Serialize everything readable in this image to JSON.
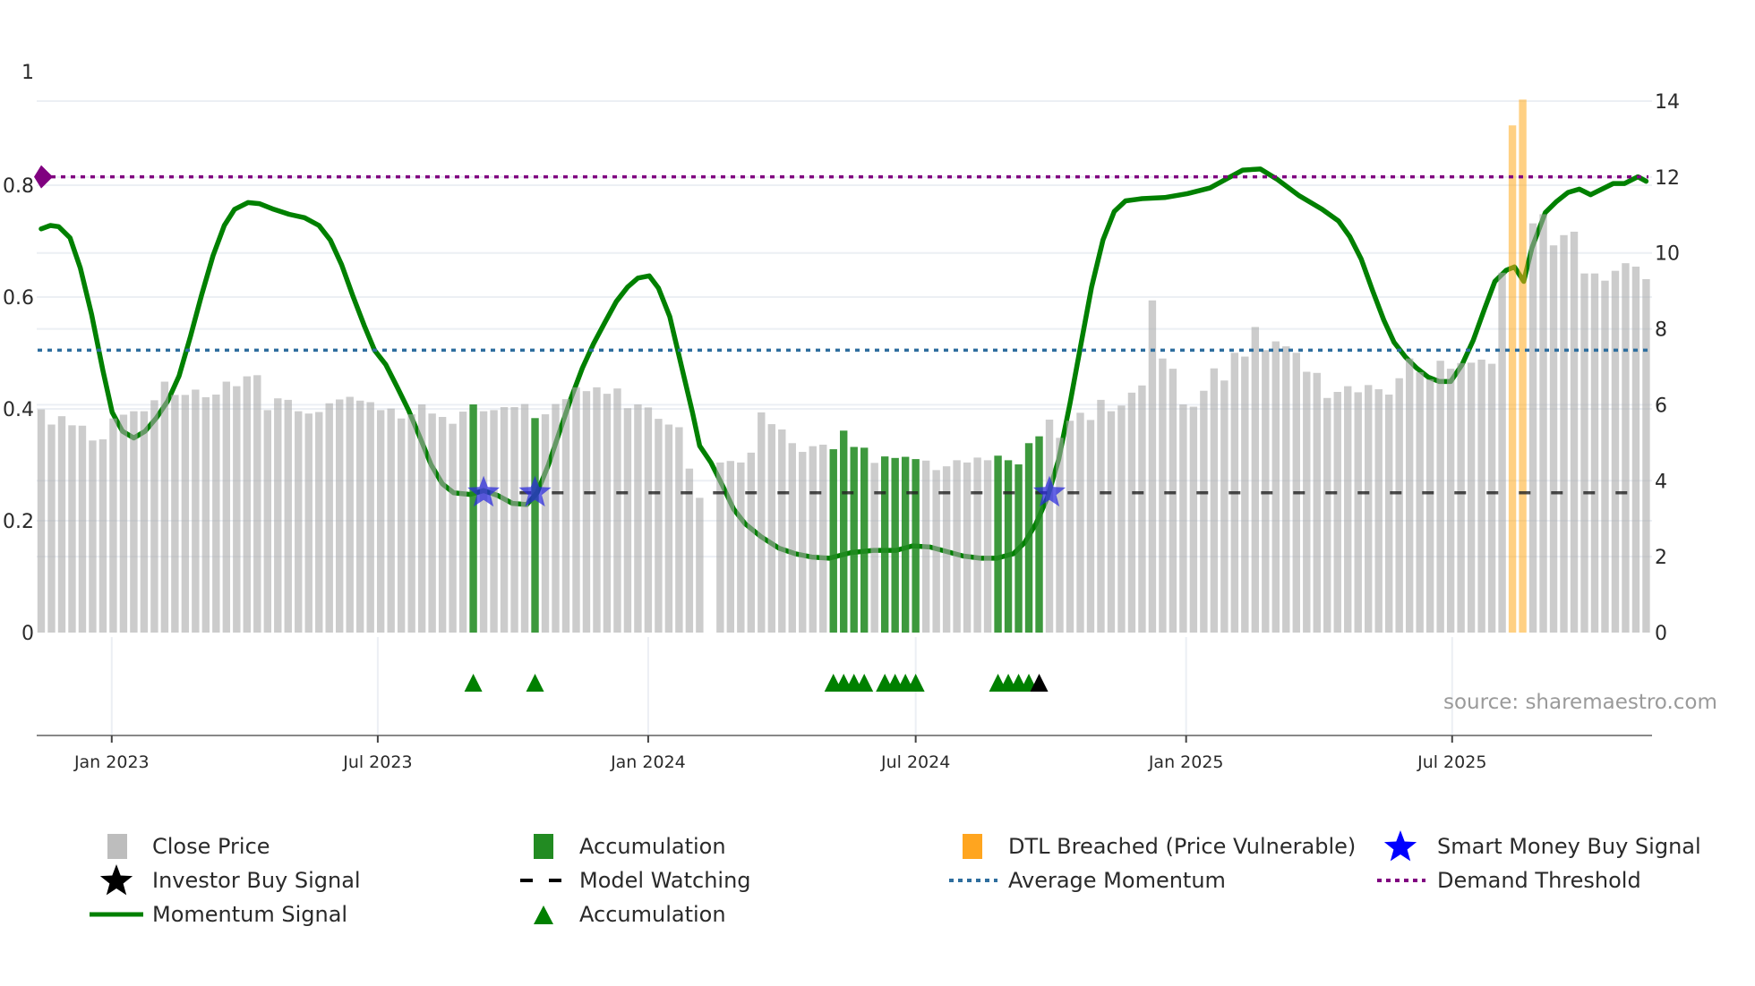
{
  "chart_data": {
    "type": "bar",
    "title": "",
    "source": "source: sharemaestro.com",
    "x_start_date": "2022-11-14",
    "x_interval_days": 7,
    "x_ticks": [
      {
        "label": "Jan 2023",
        "date": "2023-01-01"
      },
      {
        "label": "Jul 2023",
        "date": "2023-07-01"
      },
      {
        "label": "Jan 2024",
        "date": "2024-01-01"
      },
      {
        "label": "Jul 2024",
        "date": "2024-07-01"
      },
      {
        "label": "Jan 2025",
        "date": "2025-01-01"
      },
      {
        "label": "Jul 2025",
        "date": "2025-07-01"
      }
    ],
    "left_axis": {
      "range": [
        0,
        1
      ],
      "ticks": [
        "0",
        "0.2",
        "0.4",
        "0.6",
        "0.8",
        "1"
      ],
      "tick_values": [
        0,
        0.2,
        0.4,
        0.6,
        0.8,
        1
      ]
    },
    "right_axis": {
      "range": [
        0,
        14.74
      ],
      "ticks": [
        "0",
        "2",
        "4",
        "6",
        "8",
        "10",
        "12",
        "14"
      ],
      "tick_values": [
        0,
        2,
        4,
        6,
        8,
        10,
        12,
        14
      ]
    },
    "grid": true,
    "legend_placement": "bottom",
    "close_price": [
      5.88,
      5.48,
      5.7,
      5.46,
      5.45,
      5.06,
      5.09,
      5.64,
      5.74,
      5.83,
      5.83,
      6.12,
      6.61,
      6.26,
      6.26,
      6.4,
      6.2,
      6.27,
      6.61,
      6.49,
      6.75,
      6.78,
      5.86,
      6.17,
      6.13,
      5.83,
      5.77,
      5.81,
      6.04,
      6.14,
      6.21,
      6.11,
      6.07,
      5.86,
      5.9,
      5.64,
      5.75,
      6.01,
      5.77,
      5.68,
      5.5,
      5.82,
      6.01,
      5.83,
      5.86,
      5.94,
      5.94,
      6.02,
      5.65,
      5.75,
      6.02,
      6.15,
      6.46,
      6.36,
      6.46,
      6.29,
      6.43,
      5.91,
      6.01,
      5.93,
      5.63,
      5.48,
      5.41,
      4.32,
      3.55,
      null,
      4.48,
      4.52,
      4.48,
      4.74,
      5.8,
      5.49,
      5.35,
      4.99,
      4.76,
      4.91,
      4.95,
      4.83,
      5.32,
      4.89,
      4.87,
      4.47,
      4.64,
      4.6,
      4.63,
      4.57,
      4.53,
      4.28,
      4.38,
      4.54,
      4.48,
      4.61,
      4.54,
      4.66,
      4.54,
      4.43,
      4.99,
      5.17,
      5.61,
      5.13,
      5.58,
      5.79,
      5.6,
      6.13,
      5.83,
      5.98,
      6.32,
      6.51,
      8.75,
      7.22,
      6.95,
      6.01,
      5.95,
      6.37,
      6.96,
      6.64,
      7.37,
      7.27,
      8.05,
      7.44,
      7.67,
      7.54,
      7.37,
      6.87,
      6.84,
      6.18,
      6.34,
      6.49,
      6.33,
      6.52,
      6.41,
      6.27,
      6.7,
      7.22,
      6.86,
      6.67,
      7.16,
      6.95,
      7.1,
      7.11,
      7.19,
      7.08,
      9.48,
      13.36,
      14.04,
      10.78,
      11.02,
      10.2,
      10.47,
      10.56,
      9.46,
      9.46,
      9.27,
      9.53,
      9.73,
      9.64,
      9.31
    ],
    "accumulation_bar_indices": [
      42,
      48,
      77,
      78,
      79,
      80,
      82,
      83,
      84,
      85,
      93,
      94,
      95,
      96,
      97
    ],
    "dtl_breached_bar_indices": [
      143,
      144
    ],
    "accumulation_triangles": [
      {
        "i": 42,
        "color": "#008000"
      },
      {
        "i": 48,
        "color": "#008000"
      },
      {
        "i": 77,
        "color": "#008000"
      },
      {
        "i": 78,
        "color": "#008000"
      },
      {
        "i": 79,
        "color": "#008000"
      },
      {
        "i": 80,
        "color": "#008000"
      },
      {
        "i": 82,
        "color": "#008000"
      },
      {
        "i": 83,
        "color": "#008000"
      },
      {
        "i": 84,
        "color": "#008000"
      },
      {
        "i": 85,
        "color": "#008000"
      },
      {
        "i": 93,
        "color": "#008000"
      },
      {
        "i": 94,
        "color": "#008000"
      },
      {
        "i": 95,
        "color": "#008000"
      },
      {
        "i": 96,
        "color": "#008000"
      },
      {
        "i": 97,
        "color": "#000000"
      }
    ],
    "smart_money_signals": [
      {
        "i": 43,
        "value": 0.25
      },
      {
        "i": 48,
        "value": 0.25
      },
      {
        "i": 98,
        "value": 0.25
      }
    ],
    "model_watching": {
      "value": 0.25,
      "from_index": 46.5,
      "to_index": 156
    },
    "average_momentum": 0.505,
    "demand_threshold": 0.815,
    "momentum_signal": [
      [
        0,
        0.722
      ],
      [
        0.9,
        0.728
      ],
      [
        1.7,
        0.726
      ],
      [
        2.8,
        0.706
      ],
      [
        3.8,
        0.652
      ],
      [
        4.9,
        0.569
      ],
      [
        6.0,
        0.469
      ],
      [
        6.9,
        0.394
      ],
      [
        7.9,
        0.36
      ],
      [
        9.0,
        0.348
      ],
      [
        10.1,
        0.36
      ],
      [
        11.2,
        0.384
      ],
      [
        12.3,
        0.414
      ],
      [
        13.4,
        0.459
      ],
      [
        14.5,
        0.529
      ],
      [
        15.6,
        0.604
      ],
      [
        16.7,
        0.674
      ],
      [
        17.8,
        0.728
      ],
      [
        18.8,
        0.757
      ],
      [
        20.1,
        0.769
      ],
      [
        21.2,
        0.767
      ],
      [
        22.6,
        0.757
      ],
      [
        24.1,
        0.748
      ],
      [
        25.6,
        0.742
      ],
      [
        27.0,
        0.728
      ],
      [
        28.1,
        0.702
      ],
      [
        29.2,
        0.658
      ],
      [
        30.3,
        0.602
      ],
      [
        31.4,
        0.549
      ],
      [
        32.4,
        0.505
      ],
      [
        33.5,
        0.479
      ],
      [
        34.6,
        0.439
      ],
      [
        35.7,
        0.398
      ],
      [
        36.8,
        0.35
      ],
      [
        37.9,
        0.3
      ],
      [
        39.0,
        0.266
      ],
      [
        40.1,
        0.25
      ],
      [
        41.7,
        0.247
      ],
      [
        43.0,
        0.254
      ],
      [
        44.4,
        0.245
      ],
      [
        45.8,
        0.231
      ],
      [
        47.2,
        0.229
      ],
      [
        48.2,
        0.25
      ],
      [
        49.3,
        0.3
      ],
      [
        50.4,
        0.36
      ],
      [
        51.5,
        0.419
      ],
      [
        52.6,
        0.473
      ],
      [
        53.7,
        0.517
      ],
      [
        54.8,
        0.555
      ],
      [
        55.9,
        0.592
      ],
      [
        57.0,
        0.618
      ],
      [
        58.0,
        0.634
      ],
      [
        59.1,
        0.638
      ],
      [
        60.0,
        0.616
      ],
      [
        61.1,
        0.565
      ],
      [
        62.2,
        0.479
      ],
      [
        63.3,
        0.394
      ],
      [
        64.0,
        0.334
      ],
      [
        65.1,
        0.304
      ],
      [
        66.2,
        0.264
      ],
      [
        67.3,
        0.221
      ],
      [
        68.4,
        0.195
      ],
      [
        70.0,
        0.171
      ],
      [
        71.7,
        0.151
      ],
      [
        73.3,
        0.141
      ],
      [
        74.9,
        0.135
      ],
      [
        76.6,
        0.133
      ],
      [
        78.7,
        0.143
      ],
      [
        80.9,
        0.147
      ],
      [
        83.1,
        0.147
      ],
      [
        84.7,
        0.155
      ],
      [
        86.4,
        0.153
      ],
      [
        88.0,
        0.145
      ],
      [
        89.6,
        0.137
      ],
      [
        91.3,
        0.133
      ],
      [
        92.9,
        0.133
      ],
      [
        94.5,
        0.141
      ],
      [
        95.6,
        0.161
      ],
      [
        96.7,
        0.195
      ],
      [
        97.8,
        0.241
      ],
      [
        98.9,
        0.31
      ],
      [
        100.0,
        0.41
      ],
      [
        101.1,
        0.519
      ],
      [
        102.1,
        0.618
      ],
      [
        103.2,
        0.702
      ],
      [
        104.3,
        0.753
      ],
      [
        105.4,
        0.772
      ],
      [
        107.0,
        0.776
      ],
      [
        109.2,
        0.778
      ],
      [
        111.4,
        0.785
      ],
      [
        113.6,
        0.795
      ],
      [
        115.2,
        0.811
      ],
      [
        116.8,
        0.827
      ],
      [
        118.5,
        0.829
      ],
      [
        120.1,
        0.811
      ],
      [
        122.3,
        0.781
      ],
      [
        124.5,
        0.757
      ],
      [
        126.1,
        0.736
      ],
      [
        127.2,
        0.708
      ],
      [
        128.3,
        0.668
      ],
      [
        129.4,
        0.612
      ],
      [
        130.5,
        0.559
      ],
      [
        131.5,
        0.519
      ],
      [
        132.6,
        0.493
      ],
      [
        133.7,
        0.473
      ],
      [
        134.8,
        0.457
      ],
      [
        135.9,
        0.449
      ],
      [
        137.0,
        0.449
      ],
      [
        138.1,
        0.479
      ],
      [
        139.2,
        0.523
      ],
      [
        140.3,
        0.579
      ],
      [
        141.3,
        0.628
      ],
      [
        142.4,
        0.648
      ],
      [
        143.2,
        0.654
      ],
      [
        144.1,
        0.628
      ],
      [
        144.9,
        0.688
      ],
      [
        146.2,
        0.751
      ],
      [
        147.3,
        0.771
      ],
      [
        148.4,
        0.787
      ],
      [
        149.5,
        0.793
      ],
      [
        150.6,
        0.783
      ],
      [
        151.7,
        0.793
      ],
      [
        152.8,
        0.803
      ],
      [
        153.9,
        0.803
      ],
      [
        155.2,
        0.815
      ],
      [
        156,
        0.807
      ]
    ],
    "legend": [
      {
        "label": "Close Price",
        "icon": "gray-square",
        "color": "#bdbdbd"
      },
      {
        "label": "Accumulation",
        "icon": "green-square",
        "color": "#228b22"
      },
      {
        "label": "DTL Breached (Price Vulnerable)",
        "icon": "orange-square",
        "color": "#ffa500"
      },
      {
        "label": "Smart Money Buy Signal",
        "icon": "blue-star",
        "color": "#0000ff"
      },
      {
        "label": "Investor Buy Signal",
        "icon": "black-star",
        "color": "#000000"
      },
      {
        "label": "Model Watching",
        "icon": "dashed-line",
        "color": "#000000"
      },
      {
        "label": "Average Momentum",
        "icon": "dotted-line",
        "color": "#2e6e9e"
      },
      {
        "label": "Demand Threshold",
        "icon": "dotted-line",
        "color": "#800080"
      },
      {
        "label": "Momentum Signal",
        "icon": "solid-line",
        "color": "#008000"
      },
      {
        "label": "Accumulation",
        "icon": "green-triangle",
        "color": "#008000"
      }
    ]
  },
  "colors": {
    "close_price": "#aaaaaa",
    "accumulation": "#228b22",
    "dtl": "#ffa500",
    "momentum": "#008000",
    "average_momentum": "#2e6e9e",
    "demand_threshold": "#800080",
    "smart_money": "#0000ff",
    "model_watching": "#222222",
    "grid": "#eceff4",
    "axis": "#888888"
  }
}
